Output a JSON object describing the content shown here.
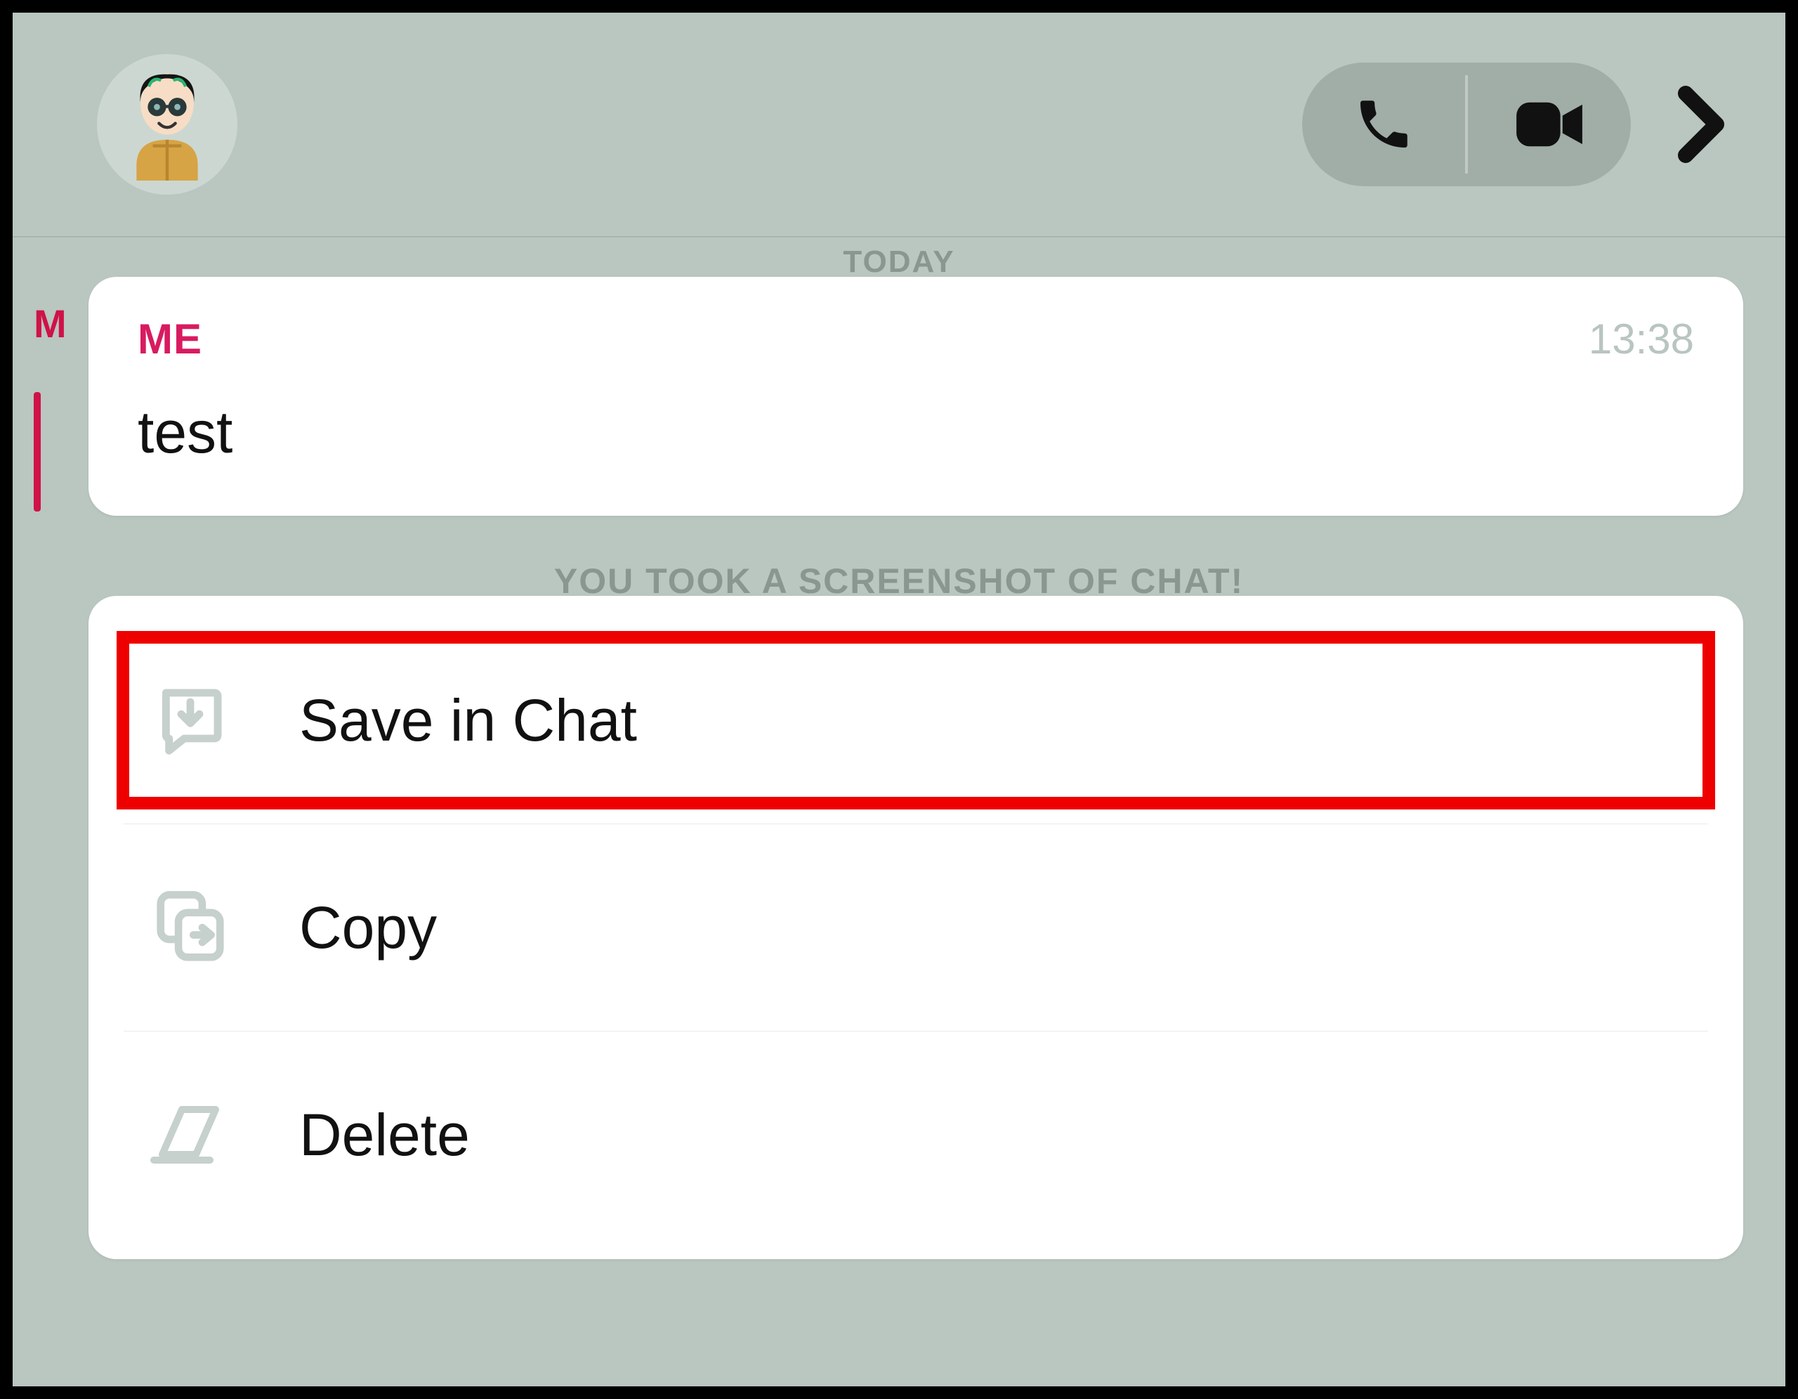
{
  "header": {
    "avatar_alt": "bitmoji-avatar",
    "call_icon": "phone-icon",
    "video_icon": "video-icon",
    "expand_icon": "chevron-right-icon"
  },
  "chat": {
    "date_label": "TODAY",
    "behind_sender_initial": "M",
    "sender": "ME",
    "time": "13:38",
    "message": "test",
    "system_notice": "YOU TOOK A SCREENSHOT OF CHAT!"
  },
  "menu": {
    "items": [
      {
        "id": "save",
        "label": "Save in Chat",
        "icon": "save-in-chat-icon",
        "highlighted": true
      },
      {
        "id": "copy",
        "label": "Copy",
        "icon": "copy-icon",
        "highlighted": false
      },
      {
        "id": "delete",
        "label": "Delete",
        "icon": "erase-icon",
        "highlighted": false
      }
    ]
  }
}
